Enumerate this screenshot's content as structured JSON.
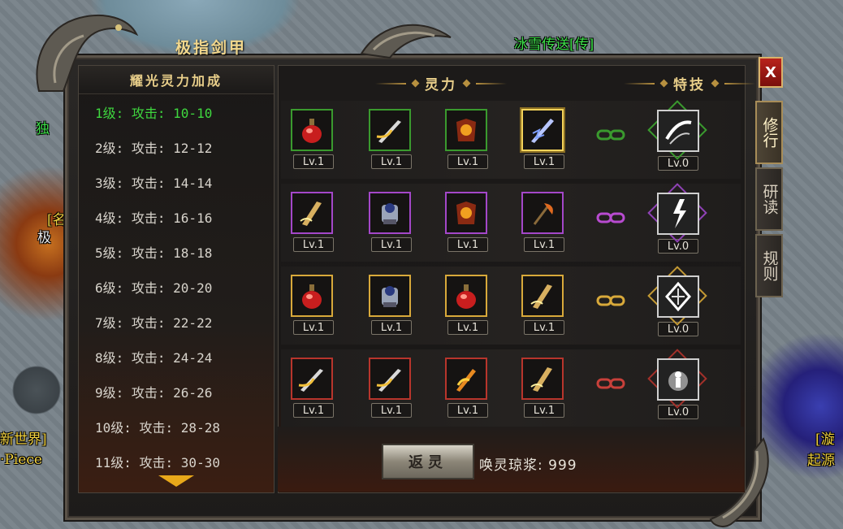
{
  "world": {
    "top_label": "冰雪传送[传]",
    "left_partial_1": "独",
    "left_partial_2": "[名",
    "left_partial_3": "极",
    "left_partial_4": "新世界]",
    "left_partial_5": "·Piece",
    "right_partial_1": "[漩",
    "right_partial_2": "起源"
  },
  "panel": {
    "title": "极指剑甲",
    "close_label": "X"
  },
  "side_tabs": [
    {
      "label": "修行",
      "active": true
    },
    {
      "label": "研读",
      "active": false
    },
    {
      "label": "规则",
      "active": false
    }
  ],
  "left_list": {
    "header": "耀光灵力加成",
    "levels": [
      "1级: 攻击: 10-10",
      "2级: 攻击: 12-12",
      "3级: 攻击: 14-14",
      "4级: 攻击: 16-16",
      "5级: 攻击: 18-18",
      "6级: 攻击: 20-20",
      "7级: 攻击: 22-22",
      "8级: 攻击: 24-24",
      "9级: 攻击: 26-26",
      "10级: 攻击: 28-28",
      "11级: 攻击: 30-30"
    ]
  },
  "sections": {
    "lingli": "灵力",
    "teji": "特技"
  },
  "rows": [
    {
      "tier": "green",
      "items": [
        "Lv.1",
        "Lv.1",
        "Lv.1",
        "Lv.1"
      ],
      "icons": [
        "potion-icon",
        "sword-icon",
        "armor-icon",
        "lightning-blade-icon"
      ],
      "special_lv": "Lv.0",
      "special_icon": "slash-icon"
    },
    {
      "tier": "purple",
      "items": [
        "Lv.1",
        "Lv.1",
        "Lv.1",
        "Lv.1"
      ],
      "icons": [
        "blade-icon",
        "robot-armor-icon",
        "armor-icon",
        "axe-icon"
      ],
      "special_lv": "Lv.0",
      "special_icon": "lightning-strike-icon"
    },
    {
      "tier": "gold",
      "items": [
        "Lv.1",
        "Lv.1",
        "Lv.1",
        "Lv.1"
      ],
      "icons": [
        "potion-icon",
        "robot-armor-icon",
        "potion-icon",
        "blade-icon"
      ],
      "special_lv": "Lv.0",
      "special_icon": "shatter-icon"
    },
    {
      "tier": "red",
      "items": [
        "Lv.1",
        "Lv.1",
        "Lv.1",
        "Lv.1"
      ],
      "icons": [
        "sword-icon",
        "sword-icon",
        "flame-sword-icon",
        "blade-icon"
      ],
      "special_lv": "Lv.0",
      "special_icon": "aura-burst-icon"
    }
  ],
  "bottom": {
    "return_label": "返灵",
    "currency_text": "唤灵琼浆: 999"
  },
  "colors": {
    "green": "#3a9a2e",
    "purple": "#a447c9",
    "gold": "#d8a93a",
    "red": "#b8352c"
  }
}
